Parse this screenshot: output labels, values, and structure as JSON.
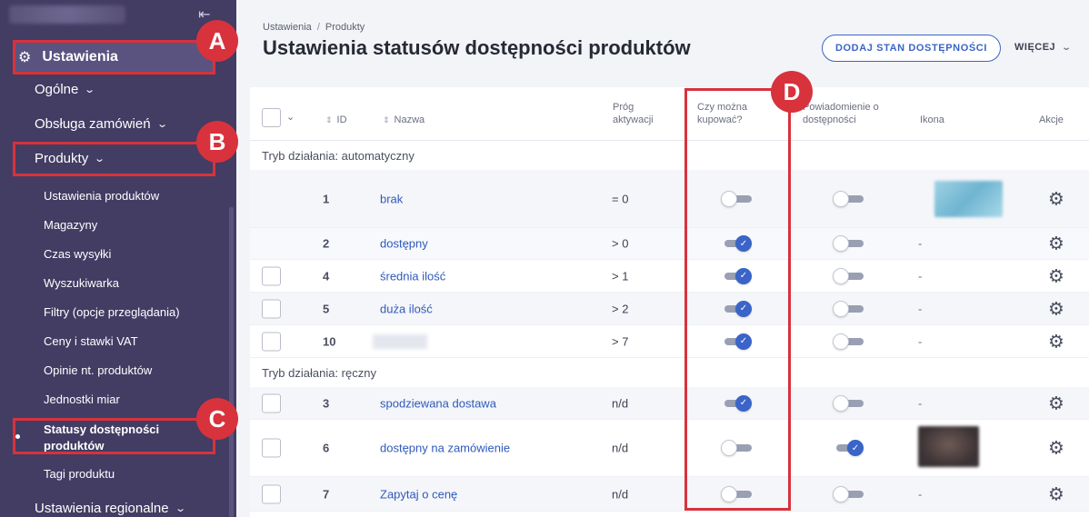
{
  "sidebar": {
    "main_item": "Ustawienia",
    "items": {
      "ogolne": "Ogólne",
      "obsluga": "Obsługa zamówień",
      "produkty": "Produkty",
      "regionalne": "Ustawienia regionalne"
    },
    "sub_items": [
      "Ustawienia produktów",
      "Magazyny",
      "Czas wysyłki",
      "Wyszukiwarka",
      "Filtry (opcje przeglądania)",
      "Ceny i stawki VAT",
      "Opinie nt. produktów",
      "Jednostki miar",
      "Statusy dostępności produktów",
      "Tagi produktu"
    ]
  },
  "callouts": {
    "a": "A",
    "b": "B",
    "c": "C",
    "d": "D"
  },
  "breadcrumb": {
    "first": "Ustawienia",
    "separator": "/",
    "second": "Produkty"
  },
  "page_title": "Ustawienia statusów dostępności produktów",
  "actions": {
    "add": "DODAJ STAN DOSTĘPNOŚCI",
    "more": "WIĘCEJ"
  },
  "table": {
    "headers": {
      "id": "ID",
      "name": "Nazwa",
      "threshold": "Próg aktywacji",
      "can_buy": "Czy można kupować?",
      "notification": "Powiadomienie o dostępności",
      "icon": "Ikona",
      "actions": "Akcje"
    },
    "groups": {
      "auto": "Tryb działania: automatyczny",
      "manual": "Tryb działania: ręczny"
    },
    "rows": [
      {
        "id": "1",
        "name": "brak",
        "threshold": "= 0",
        "can_buy": false,
        "notify": false,
        "icon": "image",
        "checkbox": false
      },
      {
        "id": "2",
        "name": "dostępny",
        "threshold": "> 0",
        "can_buy": true,
        "notify": false,
        "icon": "-",
        "checkbox": false
      },
      {
        "id": "4",
        "name": "średnia ilość",
        "threshold": "> 1",
        "can_buy": true,
        "notify": false,
        "icon": "-",
        "checkbox": true
      },
      {
        "id": "5",
        "name": "duża ilość",
        "threshold": "> 2",
        "can_buy": true,
        "notify": false,
        "icon": "-",
        "checkbox": true
      },
      {
        "id": "10",
        "name": "",
        "threshold": "> 7",
        "can_buy": true,
        "notify": false,
        "icon": "-",
        "checkbox": true
      },
      {
        "id": "3",
        "name": "spodziewana dostawa",
        "threshold": "n/d",
        "can_buy": true,
        "notify": false,
        "icon": "-",
        "checkbox": true
      },
      {
        "id": "6",
        "name": "dostępny na zamówienie",
        "threshold": "n/d",
        "can_buy": false,
        "notify": true,
        "icon": "image",
        "checkbox": true
      },
      {
        "id": "7",
        "name": "Zapytaj o cenę",
        "threshold": "n/d",
        "can_buy": false,
        "notify": false,
        "icon": "-",
        "checkbox": true
      }
    ]
  },
  "colors": {
    "highlight": "#d8323c",
    "accent": "#3a64c8",
    "sidebar": "#433c63"
  }
}
